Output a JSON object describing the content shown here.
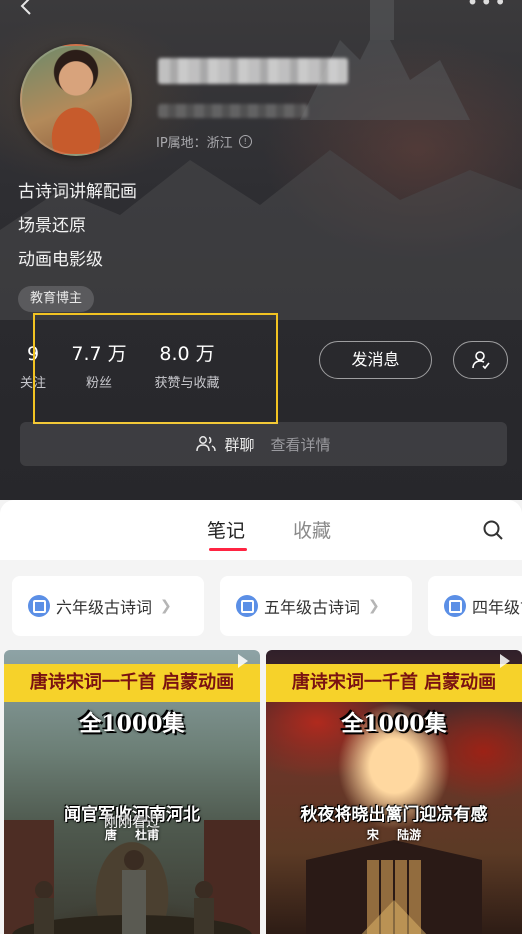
{
  "profile": {
    "ip_location": "IP属地：浙江",
    "bio": [
      "古诗词讲解配画",
      "场景还原",
      "动画电影级"
    ],
    "tag": "教育博主"
  },
  "stats": [
    {
      "value": "9",
      "label": "关注"
    },
    {
      "value": "7.7 万",
      "label": "粉丝"
    },
    {
      "value": "8.0 万",
      "label": "获赞与收藏"
    }
  ],
  "actions": {
    "message_label": "发消息"
  },
  "group": {
    "label": "群聊",
    "detail": "查看详情"
  },
  "tabs": [
    "笔记",
    "收藏"
  ],
  "collections": [
    "六年级古诗词",
    "五年级古诗词",
    "四年级古诗词"
  ],
  "cards": [
    {
      "banner": "唐诗宋词一千首 启蒙动画",
      "series": "全1000集",
      "poem": "闻官军收河南河北",
      "author": "唐 杜甫",
      "seen": "刚刚看过"
    },
    {
      "banner": "唐诗宋词一千首 启蒙动画",
      "series": "全1000集",
      "poem": "秋夜将晓出篱门迎凉有感",
      "author": "宋 陆游"
    }
  ],
  "colors": {
    "accent": "#ff2442",
    "highlight": "#f2c322",
    "banner": "#f6d22a"
  }
}
